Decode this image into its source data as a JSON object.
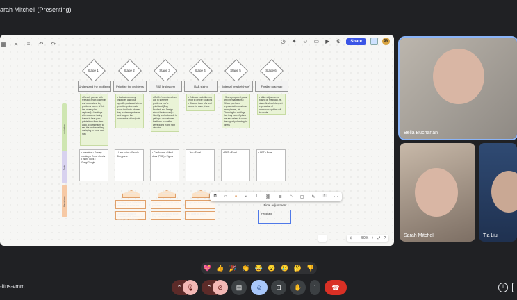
{
  "window": {
    "title": "arah Mitchell (Presenting)"
  },
  "board": {
    "share_label": "Share",
    "avatar_initials": "SM",
    "stages": [
      {
        "label": "Stage 1",
        "heading": "Understand the problems"
      },
      {
        "label": "Stage 2",
        "heading": "Prioritize the problems"
      },
      {
        "label": "Stage 3",
        "heading": "RAB brainstorm"
      },
      {
        "label": "Stage 4",
        "heading": "RAB sizing"
      },
      {
        "label": "Stage 5",
        "heading": "Internal \"marketshare\""
      },
      {
        "label": "Stage 6",
        "heading": "Finalize roadmap"
      }
    ],
    "activities": [
      "• Weekly partner with research team to identify and understand key problems (some of this has already be captured) • Meetings with customer facing teams to hear pain points from their view • Look at competitors to see the problems they are trying to solve and how",
      "• Look at company initiatives and your specific goals and aim to prioritize problems to solve that both address key customer problems and support the companies vision/goals",
      "• Get 1-2 members from you to solve the problems you're prioritized (Eng, Product, and Design should be involved) • Identify and to be able to get input on customer feedback to confirm we're going in the right direction",
      "• Estimate each & every input to deliver solutions • Discuss trade offs and scope for each phase",
      "• Share proposed plans with internal teams • Where you have representative customer facing teams, etc. Checking for red flags that they haven't plans are also raised to show the urgently planning for others",
      "• Make adjustments based on feedback, re-share finalized plan, set expectation of when/how updates will be made"
    ],
    "tools": [
      "• Interview • Survey monkey • Excel sheets • Word docs • Gong/Google",
      "• User-voice • Excel • Storyparts",
      "• Confluence • Mind docs (PRD) • Figma",
      "• Jira • Excel",
      "• PPT • Excel",
      "• PPT • Excel"
    ],
    "lanes": [
      "Activities",
      "Tools",
      "Decisions"
    ],
    "decisions": [
      {
        "title": "Decision",
        "box1": "Deciding what initial list of problems to solve are",
        "box2": "Company Initiative Potential ARR / impact of solving the problem"
      },
      {
        "title": "Decision",
        "box1": "Approach on how to solve problem",
        "box2": "UX input on how to solve, Eng. on feasibility"
      },
      {
        "title": "Decision",
        "box1": "Scope and trade offs",
        "box2": "Eng input on effort"
      }
    ],
    "selected_note": "Feedback",
    "selected_note_top": "Final adjustment",
    "zoom": "50%"
  },
  "participants": [
    {
      "name": "Bella Buchanan"
    },
    {
      "name": "Sarah Mitchell"
    },
    {
      "name": "Tia Liu"
    }
  ],
  "reactions": [
    "💖",
    "👍",
    "🎉",
    "👏",
    "😂",
    "😮",
    "😢",
    "🤔",
    "👎"
  ],
  "meeting": {
    "code": "-ftns-vmm"
  }
}
